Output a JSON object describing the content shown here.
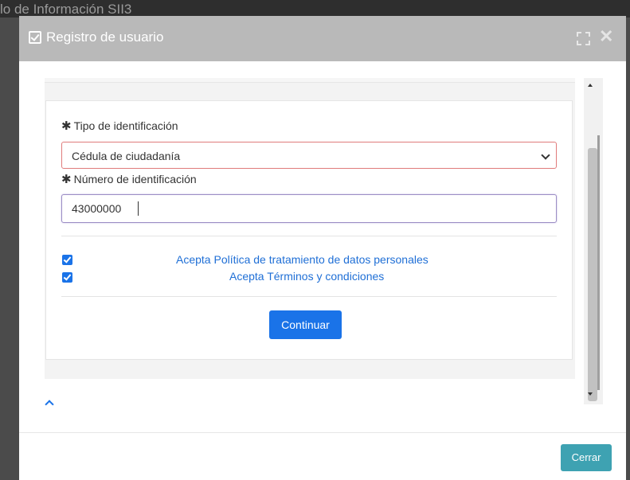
{
  "background": {
    "page_title": "lo de Información SII3"
  },
  "modal": {
    "title": "Registro de usuario",
    "icons": {
      "header": "checkbox-icon",
      "expand": "expand-icon",
      "close": "close-icon"
    }
  },
  "form": {
    "tipo_label": "Tipo de identificación",
    "tipo_selected": "Cédula de ciudadanía",
    "numero_label": "Número de identificación",
    "numero_value": "43000000",
    "required_mark": "✱",
    "checkboxes": [
      {
        "label": "Acepta Política de tratamiento de datos personales",
        "checked": true
      },
      {
        "label": "Acepta Términos y condiciones",
        "checked": true
      }
    ],
    "continue_label": "Continuar"
  },
  "footer": {
    "close_label": "Cerrar"
  },
  "colors": {
    "primary": "#1a73e8",
    "teal": "#3ea2b2",
    "header": "#b9b9b9",
    "error_border": "#e07b7b"
  }
}
